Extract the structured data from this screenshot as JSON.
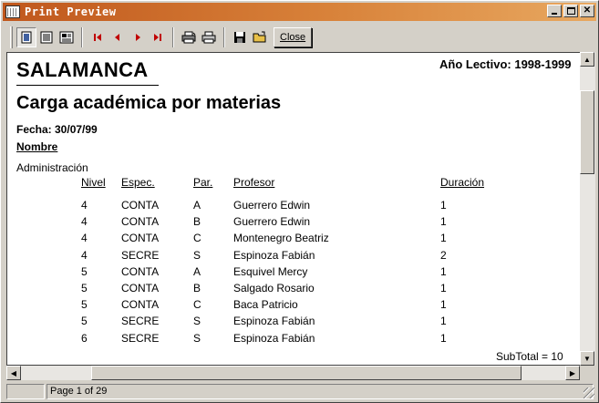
{
  "window": {
    "title": "Print Preview"
  },
  "toolbar": {
    "close_label": "Close"
  },
  "report": {
    "title": "SALAMANCA",
    "school_year": "Año Lectivo: 1998-1999",
    "subtitle": "Carga académica por materias",
    "date": "Fecha: 30/07/99",
    "name_header": "Nombre",
    "group_name": "Administración",
    "columns": [
      "Nivel",
      "Espec.",
      "Par.",
      "Profesor",
      "Duración"
    ],
    "rows": [
      [
        "4",
        "CONTA",
        "A",
        "Guerrero Edwin",
        "1"
      ],
      [
        "4",
        "CONTA",
        "B",
        "Guerrero Edwin",
        "1"
      ],
      [
        "4",
        "CONTA",
        "C",
        "Montenegro Beatriz",
        "1"
      ],
      [
        "4",
        "SECRE",
        "S",
        "Espinoza Fabián",
        "2"
      ],
      [
        "5",
        "CONTA",
        "A",
        "Esquivel Mercy",
        "1"
      ],
      [
        "5",
        "CONTA",
        "B",
        "Salgado Rosario",
        "1"
      ],
      [
        "5",
        "CONTA",
        "C",
        "Baca Patricio",
        "1"
      ],
      [
        "5",
        "SECRE",
        "S",
        "Espinoza Fabián",
        "1"
      ],
      [
        "6",
        "SECRE",
        "S",
        "Espinoza Fabián",
        "1"
      ]
    ],
    "subtotal": "SubTotal = 10"
  },
  "status": {
    "page": "Page 1 of 29"
  },
  "icons": {
    "app": "table-icon",
    "tools": [
      "whole-page-icon",
      "page-width-icon",
      "zoom-icon",
      "first-page-icon",
      "prev-page-icon",
      "next-page-icon",
      "last-page-icon",
      "print-setup-icon",
      "print-icon",
      "save-icon",
      "open-icon"
    ]
  },
  "colors": {
    "title_bar": "#c0571c",
    "nav_arrows": "#c00000",
    "face": "#d4d0c8"
  }
}
